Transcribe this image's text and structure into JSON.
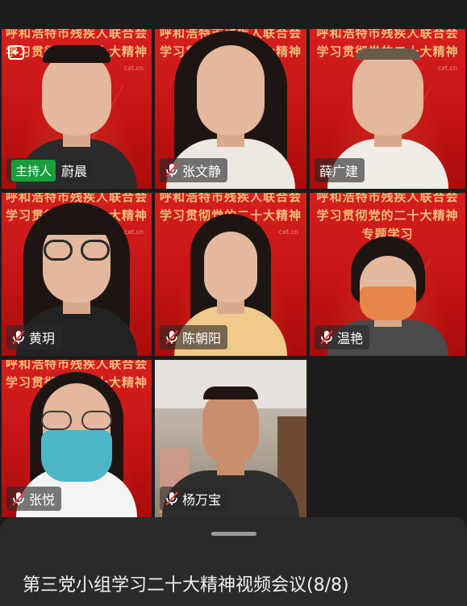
{
  "banner": {
    "line1": "呼和浩特市残疾人联合会",
    "line2": "学习贯彻党的二十大精神",
    "line3": "专题学习",
    "url": "cxt.cn"
  },
  "participants": [
    {
      "name": "蔚晨",
      "host_label": "主持人",
      "mic": "none"
    },
    {
      "name": "张文静",
      "mic": "muted"
    },
    {
      "name": "薛广建",
      "mic": "none"
    },
    {
      "name": "黄玥",
      "mic": "muted"
    },
    {
      "name": "陈朝阳",
      "mic": "muted"
    },
    {
      "name": "温艳",
      "mic": "muted"
    },
    {
      "name": "张悦",
      "mic": "muted"
    },
    {
      "name": "杨万宝",
      "mic": "muted"
    }
  ],
  "meeting": {
    "title": "第三党小组学习二十大精神视频会议(8/8)"
  },
  "icons": {
    "back": "minimize-window-icon",
    "mic": "mic-muted-icon"
  }
}
